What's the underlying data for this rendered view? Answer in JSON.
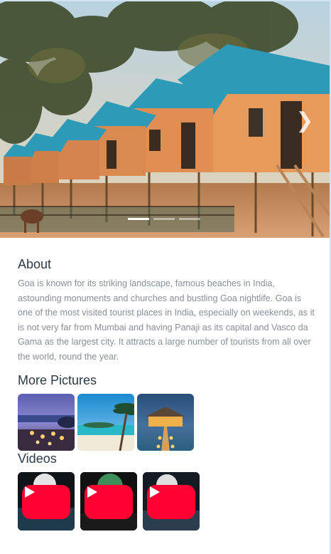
{
  "carousel": {
    "next_icon": "chevron-right-icon",
    "slides": 3,
    "active_slide": 1
  },
  "about": {
    "title": "About",
    "text": "Goa is known for its striking landscape, famous beaches in India, astounding monuments and churches and bustling Goa nightlife. Goa is one of the most visited tourist places in India, especially on weekends, as it is not very far from Mumbai and having Panaji as its capital and Vasco da Gama as the largest city. It attracts a large number of tourists from all over the world, round the year."
  },
  "pictures": {
    "title": "More Pictures",
    "items": [
      "beach-dinner-photo",
      "palm-beach-photo",
      "water-villa-photo"
    ]
  },
  "videos": {
    "title": "Videos",
    "play_icon": "youtube-play-icon",
    "count": 3
  },
  "colors": {
    "heading": "#2d3a45",
    "body_text": "#8a9099",
    "youtube_red": "#ff0033"
  }
}
